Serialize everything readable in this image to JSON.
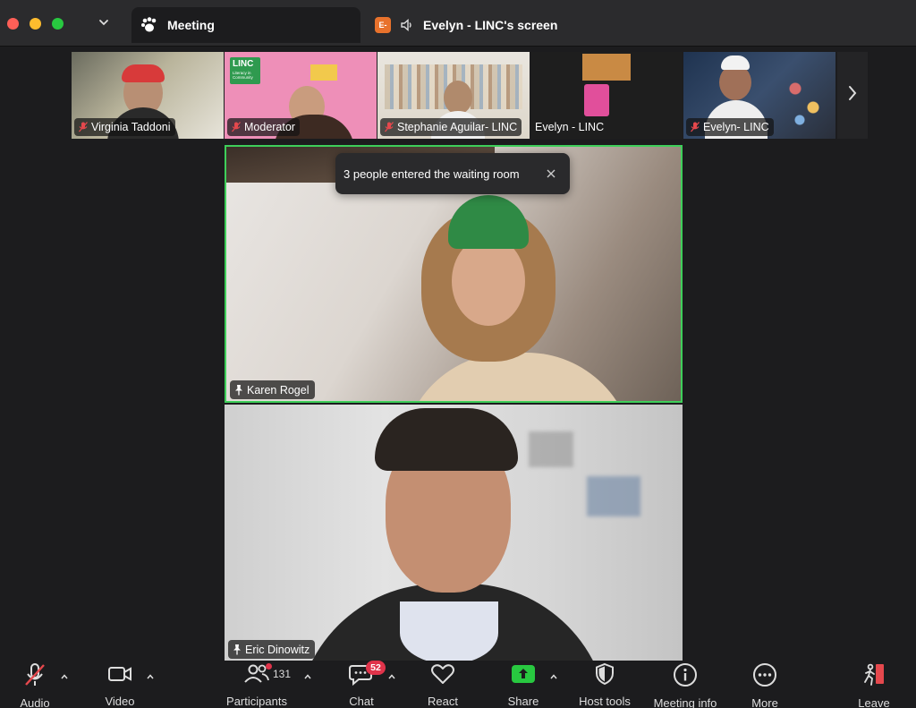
{
  "window": {
    "tabs": [
      {
        "label": "Meeting",
        "icon": "paw-icon"
      },
      {
        "label": "Evelyn - LINC's screen",
        "icon": "speaker-icon",
        "badge": "E-"
      }
    ]
  },
  "gallery": {
    "participants": [
      {
        "name": "Virginia Taddoni",
        "muted": true
      },
      {
        "name": "Moderator",
        "muted": true,
        "sign": "LINC",
        "sign_sub": "Literacy in Community"
      },
      {
        "name": "Stephanie Aguilar- LINC",
        "muted": true
      },
      {
        "name": "Evelyn - LINC",
        "muted": false
      },
      {
        "name": "Evelyn- LINC",
        "muted": true
      }
    ]
  },
  "main": {
    "speakers": [
      {
        "name": "Karen Rogel",
        "pinned": true,
        "active": true
      },
      {
        "name": "Eric Dinowitz",
        "pinned": true,
        "active": false
      }
    ],
    "notification": "3 people entered the waiting room"
  },
  "toolbar": {
    "audio": "Audio",
    "video": "Video",
    "participants": "Participants",
    "participants_count": "131",
    "chat": "Chat",
    "chat_badge": "52",
    "react": "React",
    "share": "Share",
    "host_tools": "Host tools",
    "meeting_info": "Meeting info",
    "more": "More",
    "leave": "Leave"
  },
  "colors": {
    "active_speaker_border": "#3ecf5a",
    "share_green": "#28c840",
    "badge_red": "#e0334a",
    "muted_red": "#e5484d"
  }
}
